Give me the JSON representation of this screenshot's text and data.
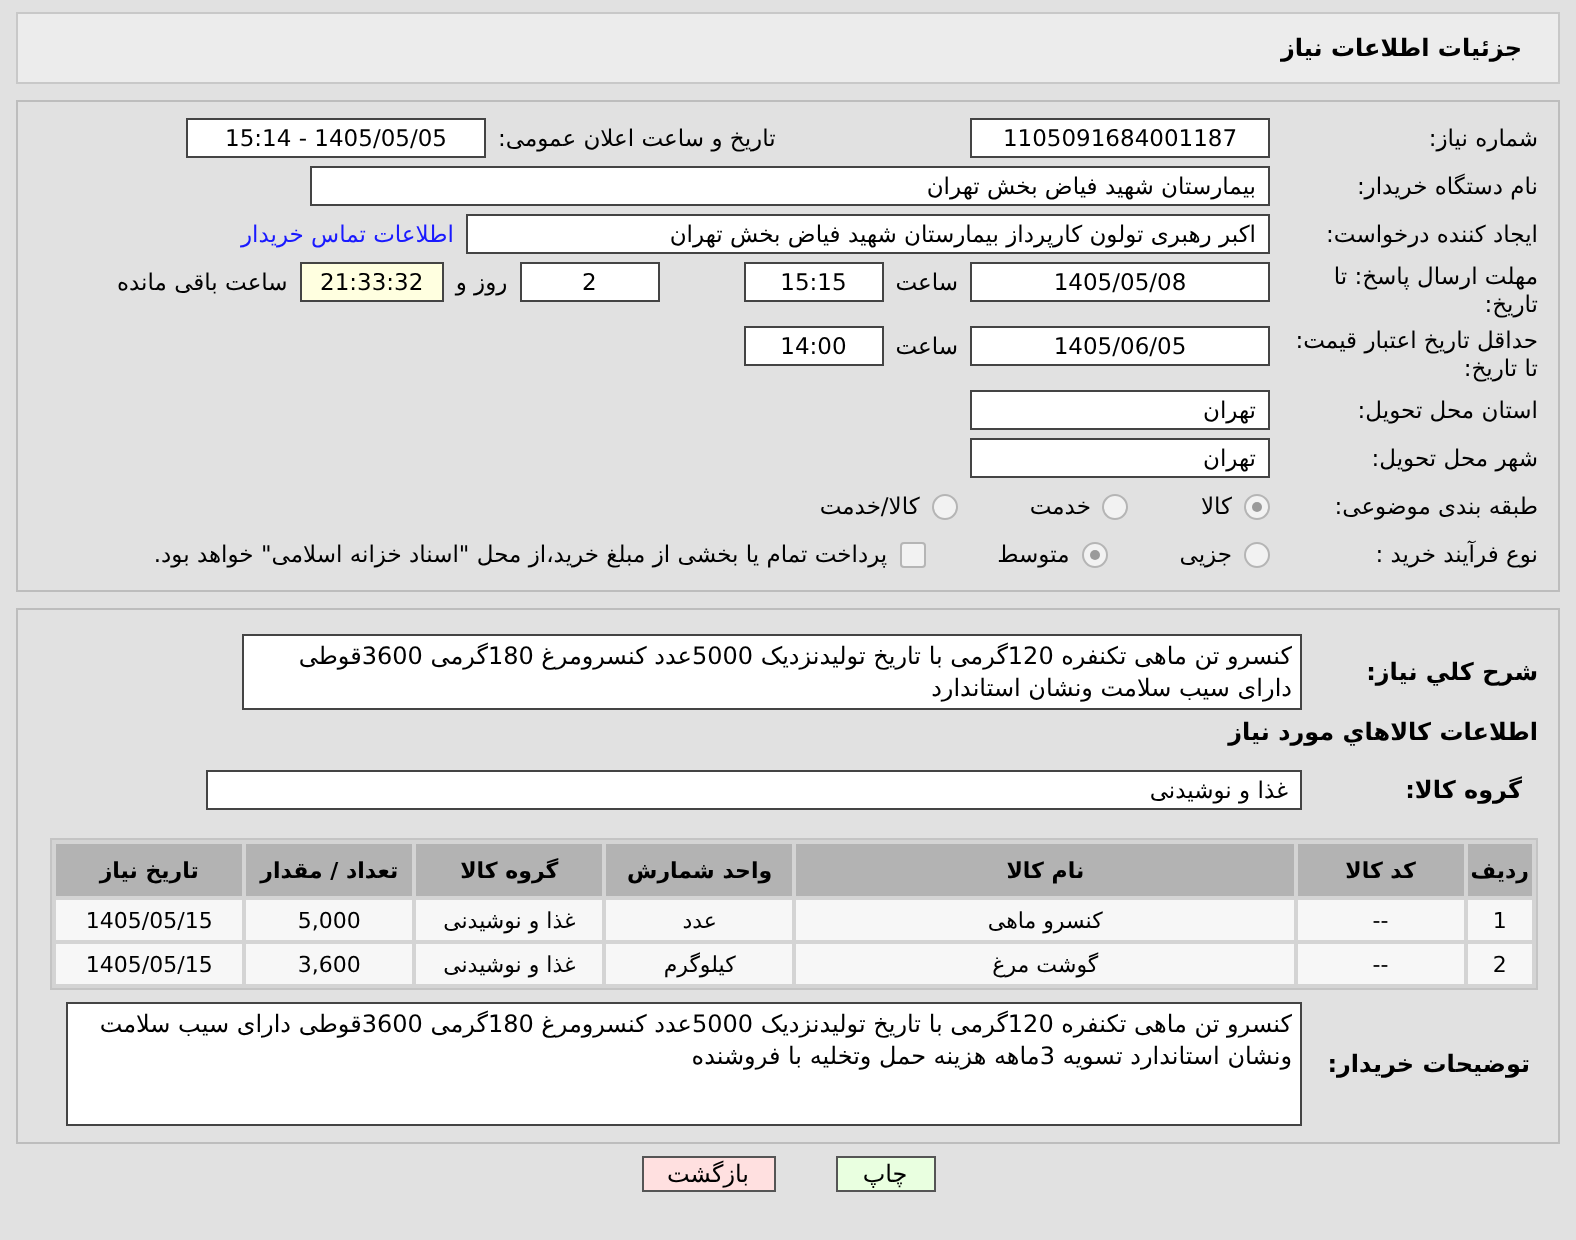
{
  "title": "جزئیات اطلاعات نیاز",
  "need_number": {
    "label": "شماره نیاز:",
    "value": "1105091684001187"
  },
  "announce": {
    "label": "تاریخ و ساعت اعلان عمومی:",
    "value": "1405/05/05 - 15:14"
  },
  "buyer_org": {
    "label": "نام دستگاه خریدار:",
    "value": "بیمارستان شهید فیاض بخش تهران"
  },
  "creator": {
    "label": "ایجاد کننده درخواست:",
    "value": "اکبر رهبری تولون کارپرداز بیمارستان شهید فیاض بخش تهران",
    "link": "اطلاعات تماس خریدار"
  },
  "deadline": {
    "label": "مهلت ارسال پاسخ: تا تاریخ:",
    "date": "1405/05/08",
    "time_label": "ساعت",
    "time": "15:15",
    "days": "2",
    "days_label": "روز و",
    "remaining": "21:33:32",
    "remaining_label": "ساعت باقی مانده"
  },
  "validity": {
    "label": "حداقل تاریخ اعتبار قیمت: تا تاریخ:",
    "date": "1405/06/05",
    "time_label": "ساعت",
    "time": "14:00"
  },
  "province": {
    "label": "استان محل تحویل:",
    "value": "تهران"
  },
  "city": {
    "label": "شهر محل تحویل:",
    "value": "تهران"
  },
  "category": {
    "label": "طبقه بندی موضوعی:",
    "options": [
      {
        "label": "کالا",
        "selected": true
      },
      {
        "label": "خدمت",
        "selected": false
      },
      {
        "label": "کالا/خدمت",
        "selected": false
      }
    ]
  },
  "process": {
    "label": "نوع فرآیند خرید :",
    "options": [
      {
        "label": "جزیی",
        "selected": false
      },
      {
        "label": "متوسط",
        "selected": true
      }
    ],
    "payment": {
      "checked": false,
      "label": "پرداخت تمام یا بخشی از مبلغ خرید،از محل \"اسناد خزانه اسلامی\" خواهد بود."
    }
  },
  "description": {
    "label": "شرح کلي نياز:",
    "value": "کنسرو تن ماهی تکنفره 120گرمی با تاریخ تولیدنزدیک 5000عدد کنسرومرغ 180گرمی 3600قوطی دارای سیب سلامت ونشان استاندارد"
  },
  "goods_heading": "اطلاعات کالاهاي مورد نياز",
  "goods_group": {
    "label": "گروه کالا:",
    "value": "غذا و نوشیدنی"
  },
  "table": {
    "columns": [
      "ردیف",
      "کد کالا",
      "نام کالا",
      "واحد شمارش",
      "گروه کالا",
      "تعداد / مقدار",
      "تاریخ نیاز"
    ],
    "rows": [
      [
        "1",
        "--",
        "کنسرو ماهی",
        "عدد",
        "غذا و نوشیدنی",
        "5,000",
        "1405/05/15"
      ],
      [
        "2",
        "--",
        "گوشت مرغ",
        "کیلوگرم",
        "غذا و نوشیدنی",
        "3,600",
        "1405/05/15"
      ]
    ]
  },
  "buyer_notes": {
    "label": "توضیحات خریدار:",
    "value": "کنسرو تن ماهی تکنفره 120گرمی با تاریخ تولیدنزدیک 5000عدد کنسرومرغ 180گرمی 3600قوطی دارای سیب سلامت ونشان استاندارد تسویه 3ماهه هزینه حمل وتخلیه با فروشنده"
  },
  "buttons": [
    {
      "label": "چاپ",
      "kind": "print"
    },
    {
      "label": "بازگشت",
      "kind": "back"
    }
  ]
}
